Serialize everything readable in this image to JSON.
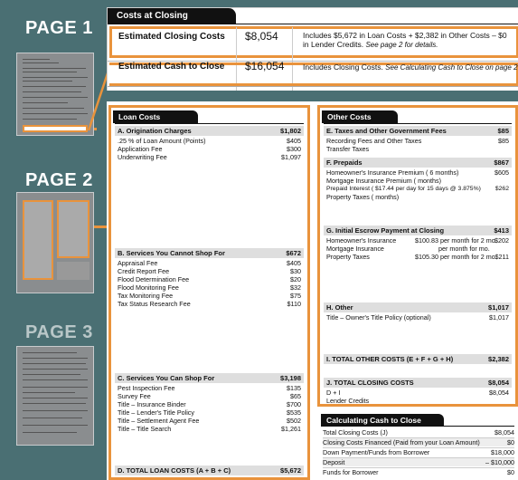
{
  "pages": {
    "page1_label": "PAGE 1",
    "page2_label": "PAGE 2",
    "page3_label": "PAGE 3"
  },
  "costs_at_closing": {
    "tab_title": "Costs at Closing",
    "estimated_closing_costs": {
      "label": "Estimated Closing Costs",
      "amount": "$8,054",
      "desc_line1": "Includes $5,672 in Loan Costs + $2,382 in Other Costs – $0",
      "desc_line2_plain": "in Lender Credits.",
      "desc_line2_italic": "See page 2 for details."
    },
    "estimated_cash_to_close": {
      "label": "Estimated Cash to Close",
      "amount": "$16,054",
      "desc_plain": "Includes Closing Costs.",
      "desc_italic": "See Calculating Cash to Close on page 2 for"
    }
  },
  "loan_costs": {
    "tab_title": "Loan Costs",
    "section_a": {
      "title": "A.  Origination Charges",
      "amount": "$1,802",
      "items": [
        {
          "label": ".25 % of Loan Amount (Points)",
          "amount": "$405"
        },
        {
          "label": "Application Fee",
          "amount": "$300"
        },
        {
          "label": "Underwriting Fee",
          "amount": "$1,097"
        }
      ]
    },
    "section_b": {
      "title": "B.  Services You Cannot Shop For",
      "amount": "$672",
      "items": [
        {
          "label": "Appraisal Fee",
          "amount": "$405"
        },
        {
          "label": "Credit Report Fee",
          "amount": "$30"
        },
        {
          "label": "Flood Determination Fee",
          "amount": "$20"
        },
        {
          "label": "Flood Monitoring Fee",
          "amount": "$32"
        },
        {
          "label": "Tax Monitoring Fee",
          "amount": "$75"
        },
        {
          "label": "Tax Status Research Fee",
          "amount": "$110"
        }
      ]
    },
    "section_c": {
      "title": "C.  Services You Can Shop For",
      "amount": "$3,198",
      "items": [
        {
          "label": "Pest Inspection Fee",
          "amount": "$135"
        },
        {
          "label": "Survey Fee",
          "amount": "$65"
        },
        {
          "label": "Title – Insurance Binder",
          "amount": "$700"
        },
        {
          "label": "Title – Lender's Title Policy",
          "amount": "$535"
        },
        {
          "label": "Title – Settlement Agent Fee",
          "amount": "$502"
        },
        {
          "label": "Title – Title Search",
          "amount": "$1,261"
        }
      ]
    },
    "section_d": {
      "title": "D.  TOTAL LOAN COSTS (A + B + C)",
      "amount": "$5,672"
    }
  },
  "other_costs": {
    "tab_title": "Other Costs",
    "section_e": {
      "title": "E.  Taxes and Other Government Fees",
      "amount": "$85",
      "items": [
        {
          "label": "Recording Fees and Other Taxes",
          "amount": "$85"
        },
        {
          "label": "Transfer Taxes",
          "amount": ""
        }
      ]
    },
    "section_f": {
      "title": "F.  Prepaids",
      "amount": "$867",
      "items": [
        {
          "label": "Homeowner's Insurance Premium (  6  months)",
          "amount": "$605"
        },
        {
          "label": "Mortgage Insurance Premium (      months)",
          "amount": ""
        },
        {
          "label": "Prepaid Interest ( $17.44 per day for 15 days @ 3.875%)",
          "amount": "$262"
        },
        {
          "label": "Property Taxes (      months)",
          "amount": ""
        }
      ]
    },
    "section_g": {
      "title": "G.  Initial Escrow Payment at Closing",
      "amount": "$413",
      "items": [
        {
          "label": "Homeowner's Insurance",
          "rate": "$100.83 per month for  2  mo.",
          "amount": "$202"
        },
        {
          "label": "Mortgage Insurance",
          "rate": "per month for      mo.",
          "amount": ""
        },
        {
          "label": "Property Taxes",
          "rate": "$105.30 per month for  2  mo.",
          "amount": "$211"
        }
      ]
    },
    "section_h": {
      "title": "H.  Other",
      "amount": "$1,017",
      "items": [
        {
          "label": "Title – Owner's Title Policy (optional)",
          "amount": "$1,017"
        }
      ]
    },
    "section_i": {
      "title": "I.  TOTAL OTHER COSTS (E + F + G + H)",
      "amount": "$2,382"
    },
    "section_j": {
      "title": "J.  TOTAL CLOSING COSTS",
      "amount": "$8,054",
      "items": [
        {
          "label": "D + I",
          "amount": "$8,054"
        },
        {
          "label": "Lender Credits",
          "amount": ""
        }
      ]
    }
  },
  "calculating_cash": {
    "tab_title": "Calculating Cash to Close",
    "items": [
      {
        "label": "Total Closing Costs (J)",
        "amount": "$8,054"
      },
      {
        "label": "Closing Costs Financed (Paid from your Loan Amount)",
        "amount": "$0"
      },
      {
        "label": "Down Payment/Funds from Borrower",
        "amount": "$18,000"
      },
      {
        "label": "Deposit",
        "amount": "– $10,000"
      },
      {
        "label": "Funds for Borrower",
        "amount": "$0"
      }
    ]
  },
  "colors": {
    "background": "#4a6f73",
    "highlight": "#e9933c",
    "tab": "#111111"
  }
}
